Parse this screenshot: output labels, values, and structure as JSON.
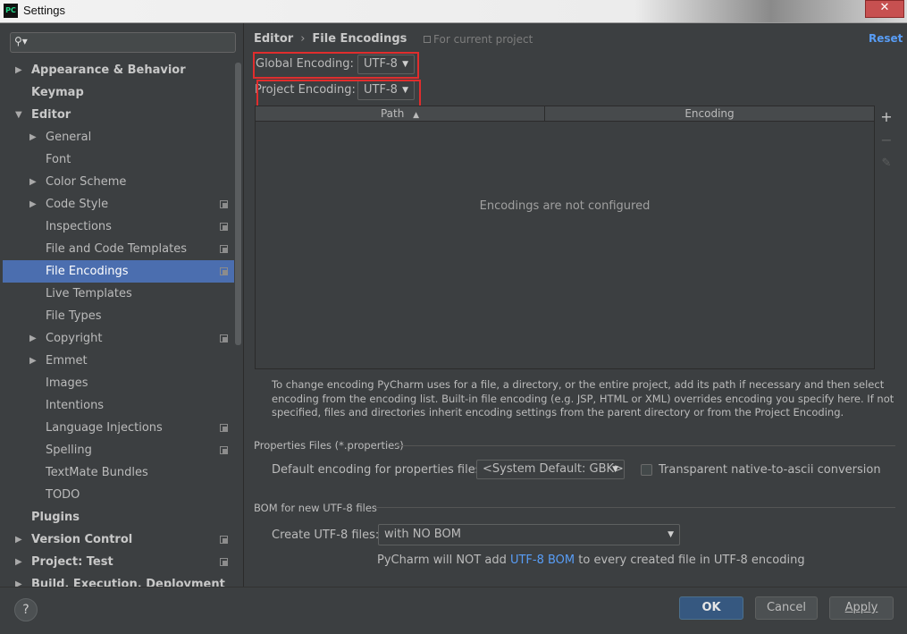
{
  "window": {
    "title": "Settings",
    "logo": "PC",
    "close_symbol": "✕"
  },
  "sidebar": {
    "search_placeholder": "",
    "items": [
      {
        "label": "Appearance & Behavior",
        "arrow": "▶"
      },
      {
        "label": "Keymap",
        "arrow": ""
      },
      {
        "label": "Editor",
        "arrow": "▼"
      },
      {
        "label": "General",
        "arrow": "▶"
      },
      {
        "label": "Font",
        "arrow": ""
      },
      {
        "label": "Color Scheme",
        "arrow": "▶"
      },
      {
        "label": "Code Style",
        "arrow": "▶"
      },
      {
        "label": "Inspections",
        "arrow": ""
      },
      {
        "label": "File and Code Templates",
        "arrow": ""
      },
      {
        "label": "File Encodings",
        "arrow": ""
      },
      {
        "label": "Live Templates",
        "arrow": ""
      },
      {
        "label": "File Types",
        "arrow": ""
      },
      {
        "label": "Copyright",
        "arrow": "▶"
      },
      {
        "label": "Emmet",
        "arrow": "▶"
      },
      {
        "label": "Images",
        "arrow": ""
      },
      {
        "label": "Intentions",
        "arrow": ""
      },
      {
        "label": "Language Injections",
        "arrow": ""
      },
      {
        "label": "Spelling",
        "arrow": ""
      },
      {
        "label": "TextMate Bundles",
        "arrow": ""
      },
      {
        "label": "TODO",
        "arrow": ""
      },
      {
        "label": "Plugins",
        "arrow": ""
      },
      {
        "label": "Version Control",
        "arrow": "▶"
      },
      {
        "label": "Project: Test",
        "arrow": "▶"
      },
      {
        "label": "Build, Execution, Deployment",
        "arrow": "▶"
      }
    ],
    "selected": "File Encodings"
  },
  "main": {
    "breadcrumb": {
      "parent": "Editor",
      "separator": "›",
      "current": "File Encodings"
    },
    "scope_label": "For current project",
    "reset_label": "Reset",
    "global_encoding": {
      "label": "Global Encoding:",
      "value": "UTF-8"
    },
    "project_encoding": {
      "label": "Project Encoding:",
      "value": "UTF-8"
    },
    "table": {
      "columns": [
        "Path",
        "Encoding"
      ],
      "sort_indicator": "▲",
      "empty_text": "Encodings are not configured",
      "toolbar": {
        "add": "+",
        "remove": "−",
        "edit": "✎"
      }
    },
    "hint": "To change encoding PyCharm uses for a file, a directory, or the entire project, add its path if necessary and then select encoding from the encoding list. Built-in file encoding (e.g. JSP, HTML or XML) overrides encoding you specify here. If not specified, files and directories inherit encoding settings from the parent directory or from the Project Encoding.",
    "properties": {
      "section_title": "Properties Files (*.properties)",
      "default_label": "Default encoding for properties files:",
      "default_value": "<System Default: GBK>",
      "transparent_label": "Transparent native-to-ascii conversion",
      "transparent_checked": false
    },
    "bom": {
      "section_title": "BOM for new UTF-8 files",
      "create_label": "Create UTF-8 files:",
      "create_value": "with NO BOM",
      "note_prefix": "PyCharm will NOT add ",
      "note_link": "UTF-8 BOM",
      "note_suffix": " to every created file in UTF-8 encoding"
    }
  },
  "footer": {
    "help": "?",
    "ok": "OK",
    "cancel": "Cancel",
    "apply": "Apply"
  },
  "colors": {
    "background": "#3c3f41",
    "selection": "#4b6eaf",
    "link": "#589df6",
    "highlight_box": "#e02d2d",
    "primary_button": "#365880"
  }
}
